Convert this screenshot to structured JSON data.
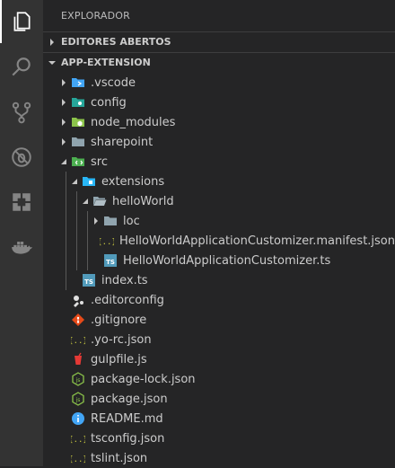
{
  "activity_bar": {
    "items": [
      {
        "name": "explorer-icon"
      },
      {
        "name": "search-icon"
      },
      {
        "name": "source-control-icon"
      },
      {
        "name": "debug-icon"
      },
      {
        "name": "extensions-icon"
      },
      {
        "name": "docker-icon"
      }
    ]
  },
  "sidebar": {
    "title": "EXPLORADOR",
    "open_editors_label": "EDITORES ABERTOS",
    "project_label": "APP-EXTENSION"
  },
  "tree": [
    {
      "label": ".vscode",
      "icon": "vscode-folder-icon",
      "twistie": "closed"
    },
    {
      "label": "config",
      "icon": "config-folder-icon",
      "twistie": "closed"
    },
    {
      "label": "node_modules",
      "icon": "node-folder-icon",
      "twistie": "closed"
    },
    {
      "label": "sharepoint",
      "icon": "folder-icon",
      "twistie": "closed"
    },
    {
      "label": "src",
      "icon": "src-folder-icon",
      "twistie": "open"
    },
    {
      "label": "extensions",
      "icon": "extensions-folder-icon",
      "twistie": "open"
    },
    {
      "label": "helloWorld",
      "icon": "folder-open-icon",
      "twistie": "open"
    },
    {
      "label": "loc",
      "icon": "folder-icon",
      "twistie": "closed"
    },
    {
      "label": "HelloWorldApplicationCustomizer.manifest.json",
      "icon": "json-icon",
      "twistie": "none"
    },
    {
      "label": "HelloWorldApplicationCustomizer.ts",
      "icon": "ts-icon",
      "twistie": "none"
    },
    {
      "label": "index.ts",
      "icon": "ts-icon",
      "twistie": "none"
    },
    {
      "label": ".editorconfig",
      "icon": "editorconfig-icon",
      "twistie": "none"
    },
    {
      "label": ".gitignore",
      "icon": "git-icon",
      "twistie": "none"
    },
    {
      "label": ".yo-rc.json",
      "icon": "json-icon",
      "twistie": "none"
    },
    {
      "label": "gulpfile.js",
      "icon": "gulp-icon",
      "twistie": "none"
    },
    {
      "label": "package-lock.json",
      "icon": "npm-icon",
      "twistie": "none"
    },
    {
      "label": "package.json",
      "icon": "npm-icon",
      "twistie": "none"
    },
    {
      "label": "README.md",
      "icon": "info-icon",
      "twistie": "none"
    },
    {
      "label": "tsconfig.json",
      "icon": "json-icon",
      "twistie": "none"
    },
    {
      "label": "tslint.json",
      "icon": "json-icon",
      "twistie": "none"
    }
  ],
  "icon_glyphs": {
    "json": "{..}",
    "ts": "TS"
  },
  "colors": {
    "activity_bar": "#333333",
    "sidebar": "#252526",
    "json": "#cbcb41",
    "ts": "#519aba",
    "folder": "#90a4ae",
    "git": "#e64a19",
    "npm": "#8bc34a",
    "info": "#42a5f5",
    "gulp": "#e53935"
  }
}
